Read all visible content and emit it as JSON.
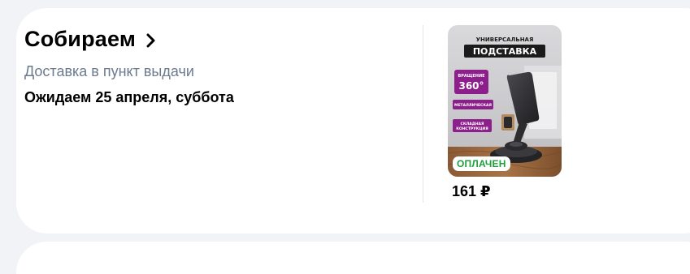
{
  "order": {
    "status_title": "Собираем",
    "delivery_type": "Доставка в пункт выдачи",
    "delivery_date": "Ожидаем 25 апреля, суббота"
  },
  "product": {
    "image_text": {
      "top_line": "УНИВЕРСАЛЬНАЯ",
      "main_line": "ПОДСТАВКА",
      "rotation_label": "ВРАЩЕНИЕ",
      "rotation_value": "360°",
      "material_label": "МЕТАЛЛИЧЕСКАЯ",
      "folding_label_1": "СКЛАДНАЯ",
      "folding_label_2": "КОНСТРУКЦИЯ"
    },
    "badge": "ОПЛАЧЕН",
    "price": "161 ₽"
  },
  "colors": {
    "page_background": "#f2f3f7",
    "card_background": "#ffffff",
    "secondary_text": "#6b7a8c",
    "paid_badge_text": "#1f9e3a",
    "promo_magenta": "#8d1f8c"
  },
  "icons": {
    "status_chevron": "chevron-right-icon"
  }
}
